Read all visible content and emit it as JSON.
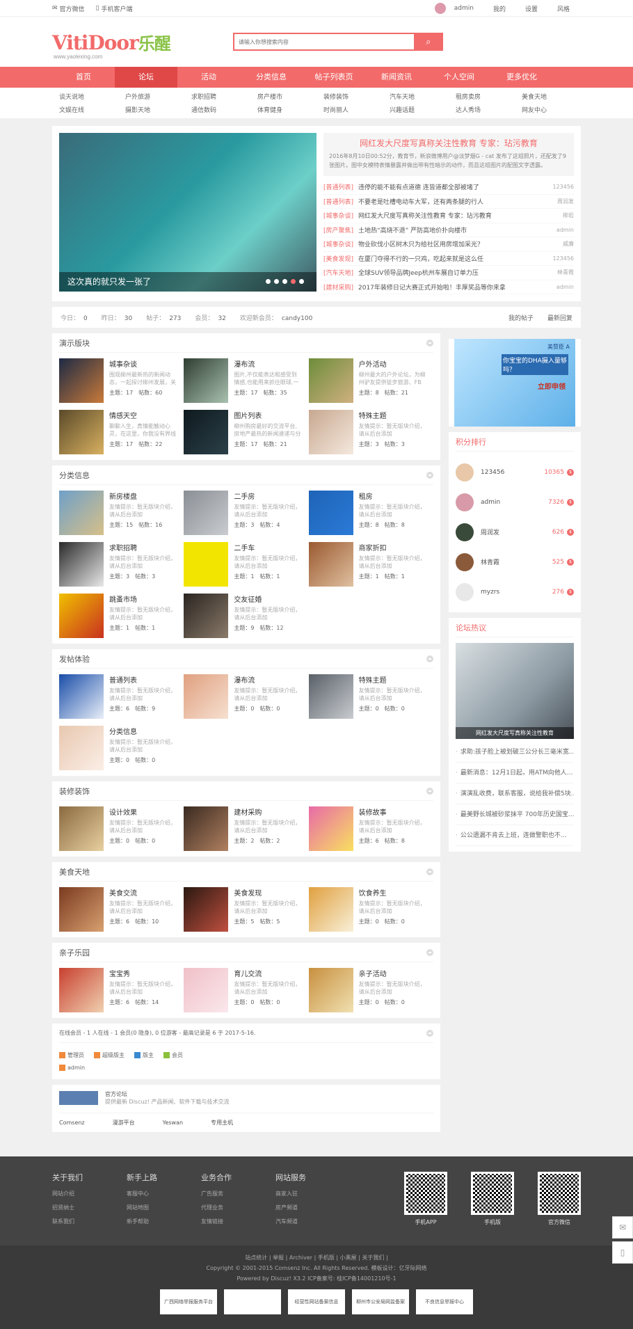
{
  "topbar": {
    "wechat": "官方微信",
    "mobile": "手机客户端",
    "user": "admin",
    "my": "我的",
    "settings": "设置",
    "style": "风格"
  },
  "header": {
    "logo_en": "VitiDoor",
    "logo_cn": "乐醒",
    "logo_url": "www.yaolexing.com",
    "search_placeholder": "请输入你想搜索内容"
  },
  "nav": [
    "首页",
    "论坛",
    "活动",
    "分类信息",
    "帖子列表页",
    "新闻资讯",
    "个人空间",
    "更多优化"
  ],
  "subnav": [
    "谈天说地",
    "户外旅游",
    "求职招聘",
    "房产楼市",
    "装修装饰",
    "汽车天地",
    "租房卖房",
    "美食天地",
    "文娱在线",
    "摄影天地",
    "通信数码",
    "体育健身",
    "时尚丽人",
    "兴趣话题",
    "达人秀场",
    "网友中心"
  ],
  "slider": {
    "caption": "这次真的就只发一张了"
  },
  "headline": {
    "title": "网红发大尺度写真称关注性教育 专家：玷污教育",
    "summary": "2016年8月10日00:52分，教育节，新浪微博用户@淡梦烟G - cat 发布了这组照片，还配发了9张图片。图中女模特表情暴露并做出带有性暗示的动作，而且这组图片的配图文字透露。"
  },
  "news": [
    {
      "cat": "[普通列表]",
      "title": "违停的能不能有点道德 连皆道都全部被堵了",
      "user": "123456"
    },
    {
      "cat": "[普通列表]",
      "title": "不要老是吐槽电动车大军，还有两条腿的行人",
      "user": "周润发"
    },
    {
      "cat": "[城事杂谈]",
      "title": "网红发大尺度写真称关注性教育 专家：玷污教育",
      "user": "柳岩"
    },
    {
      "cat": "[房产聚焦]",
      "title": "土地热“高烧不退” 严防高地价扑向楼市",
      "user": "admin"
    },
    {
      "cat": "[城事杂谈]",
      "title": "物业砍伐小区树木只为给社区用房增加采光？",
      "user": "威廉"
    },
    {
      "cat": "[美食发现]",
      "title": "在厦门夺得不行的一只鸡，吃起来就是这么任",
      "user": "123456"
    },
    {
      "cat": "[汽车天地]",
      "title": "全球SUV领导品牌Jeep杭州车展自订单力压",
      "user": "林青霞"
    },
    {
      "cat": "[建材采购]",
      "title": "2017年装修日记大赛正式开始啦！丰厚奖品等你来拿",
      "user": "admin"
    }
  ],
  "stats": {
    "today_l": "今日：",
    "today": "0",
    "yesterday_l": "昨日：",
    "yesterday": "30",
    "posts_l": "帖子：",
    "posts": "273",
    "members_l": "会员：",
    "members": "32",
    "welcome_l": "欢迎新会员：",
    "welcome": "candy100",
    "my_posts": "我的帖子",
    "latest": "最新回复"
  },
  "labels": {
    "topic": "主题：",
    "post": "帖数："
  },
  "blocks": [
    {
      "title": "演示版块",
      "forums": [
        {
          "name": "城事杂谈",
          "desc": "围观柳州最新热的新闻动态，一起探讨柳州发展，关注",
          "t": "17",
          "p": "60",
          "c1": "#1d2a44",
          "c2": "#c97a3a"
        },
        {
          "name": "瀑布流",
          "desc": "图片,不仅能表达和感受到情感,也能用来抓住眼球,一张美丽大",
          "t": "17",
          "p": "35",
          "c1": "#2f3e32",
          "c2": "#a9c1b0"
        },
        {
          "name": "户外活动",
          "desc": "柳州最大的户外论坛，为柳州驴友提供徒步旅游、FB露营。",
          "t": "8",
          "p": "21",
          "c1": "#6d8d3a",
          "c2": "#d0b080"
        },
        {
          "name": "情感天空",
          "desc": "聊聊人生，真情能触动心灵，在这里，你我没有界线的倾倒",
          "t": "17",
          "p": "22",
          "c1": "#5a4a2a",
          "c2": "#d8b060"
        },
        {
          "name": "图片列表",
          "desc": "柳州购房最好的交流平台,房地产最热的新闻速递与分享,共同",
          "t": "17",
          "p": "21",
          "c1": "#0e1a1f",
          "c2": "#2c4048"
        },
        {
          "name": "特殊主题",
          "desc": "友情提示：暂无版块介绍，请从后台添加",
          "t": "3",
          "p": "3",
          "c1": "#c8a890",
          "c2": "#f4e8de"
        }
      ]
    },
    {
      "title": "分类信息",
      "forums": [
        {
          "name": "新房楼盘",
          "desc": "友情提示：暂无版块介绍，请从后台添加",
          "t": "15",
          "p": "16",
          "c1": "#6fa0c8",
          "c2": "#d7c089"
        },
        {
          "name": "二手房",
          "desc": "友情提示：暂无版块介绍，请从后台添加",
          "t": "3",
          "p": "4",
          "c1": "#8a8f95",
          "c2": "#c9ccd0"
        },
        {
          "name": "租房",
          "desc": "友情提示：暂无版块介绍，请从后台添加",
          "t": "8",
          "p": "8",
          "c1": "#1e64b8",
          "c2": "#2a7ad6"
        },
        {
          "name": "求职招聘",
          "desc": "友情提示：暂无版块介绍，请从后台添加",
          "t": "3",
          "p": "3",
          "c1": "#2a2a2a",
          "c2": "#e8e8e8"
        },
        {
          "name": "二手车",
          "desc": "友情提示：暂无版块介绍，请从后台添加",
          "t": "1",
          "p": "1",
          "c1": "#f2e600",
          "c2": "#f2e600"
        },
        {
          "name": "商家折扣",
          "desc": "友情提示：暂无版块介绍，请从后台添加",
          "t": "1",
          "p": "1",
          "c1": "#9a5a30",
          "c2": "#e0c0a0"
        },
        {
          "name": "跳蚤市场",
          "desc": "友情提示：暂无版块介绍，请从后台添加",
          "t": "1",
          "p": "1",
          "c1": "#f0c000",
          "c2": "#c83020"
        },
        {
          "name": "交友征婚",
          "desc": "友情提示：暂无版块介绍，请从后台添加",
          "t": "9",
          "p": "12",
          "c1": "#2a2420",
          "c2": "#8a7a6a"
        }
      ]
    },
    {
      "title": "发帖体验",
      "forums": [
        {
          "name": "普通列表",
          "desc": "友情提示：暂无版块介绍，请从后台添加",
          "t": "6",
          "p": "9",
          "c1": "#1a4ea8",
          "c2": "#e8eef8"
        },
        {
          "name": "瀑布流",
          "desc": "友情提示：暂无版块介绍，请从后台添加",
          "t": "0",
          "p": "0",
          "c1": "#e0a080",
          "c2": "#f6e0d0"
        },
        {
          "name": "特殊主题",
          "desc": "友情提示：暂无版块介绍，请从后台添加",
          "t": "0",
          "p": "0",
          "c1": "#5a6068",
          "c2": "#c8ccd0"
        },
        {
          "name": "分类信息",
          "desc": "友情提示：暂无版块介绍，请从后台添加",
          "t": "0",
          "p": "0",
          "c1": "#e8c8b0",
          "c2": "#fbeee6"
        }
      ]
    },
    {
      "title": "装修装饰",
      "forums": [
        {
          "name": "设计效果",
          "desc": "友情提示：暂无版块介绍，请从后台添加",
          "t": "0",
          "p": "0",
          "c1": "#8a6a40",
          "c2": "#e8d0a0"
        },
        {
          "name": "建材采购",
          "desc": "友情提示：暂无版块介绍，请从后台添加",
          "t": "2",
          "p": "2",
          "c1": "#3a2a20",
          "c2": "#b08060"
        },
        {
          "name": "装修故事",
          "desc": "友情提示：暂无版块介绍，请从后台添加",
          "t": "6",
          "p": "8",
          "c1": "#e86aa8",
          "c2": "#f8e060"
        }
      ]
    },
    {
      "title": "美食天地",
      "forums": [
        {
          "name": "美食交流",
          "desc": "友情提示：暂无版块介绍，请从后台添加",
          "t": "6",
          "p": "10",
          "c1": "#7a3a20",
          "c2": "#d8a070"
        },
        {
          "name": "美食发现",
          "desc": "友情提示：暂无版块介绍，请从后台添加",
          "t": "5",
          "p": "5",
          "c1": "#2a1810",
          "c2": "#c05040"
        },
        {
          "name": "饮食养生",
          "desc": "友情提示：暂无版块介绍，请从后台添加",
          "t": "0",
          "p": "0",
          "c1": "#e0a040",
          "c2": "#f8f0d8"
        }
      ]
    },
    {
      "title": "亲子乐园",
      "forums": [
        {
          "name": "宝宝秀",
          "desc": "友情提示：暂无版块介绍，请从后台添加",
          "t": "6",
          "p": "14",
          "c1": "#c84030",
          "c2": "#f0d0b0"
        },
        {
          "name": "育儿交流",
          "desc": "友情提示：暂无版块介绍，请从后台添加",
          "t": "0",
          "p": "0",
          "c1": "#f0c0c8",
          "c2": "#fae8ec"
        },
        {
          "name": "亲子活动",
          "desc": "友情提示：暂无版块介绍，请从后台添加",
          "t": "0",
          "p": "0",
          "c1": "#c89040",
          "c2": "#f0e0b0"
        }
      ]
    }
  ],
  "online": {
    "summary": "在线会员 - 1 人在线 - 1 会员(0 隐身), 0 位游客 - 最高记录是 6 于 2017-5-16.",
    "legend": [
      "管理员",
      "超级版主",
      "版主",
      "会员"
    ],
    "user": "admin"
  },
  "friendlinks": {
    "name": "官方论坛",
    "desc": "提供最新 Discuz! 产品新闻、软件下载与技术交流",
    "items": [
      "Comsenz",
      "漫游平台",
      "Yeswan",
      "专用主机"
    ]
  },
  "ad": {
    "brand": "美赞臣 A",
    "headline": "你宝宝的DHA摄入量够吗？",
    "sub": "立即申领"
  },
  "ranking": {
    "title": "积分排行",
    "items": [
      {
        "name": "123456",
        "score": "10365",
        "c": "#e8c8a8"
      },
      {
        "name": "admin",
        "score": "7326",
        "c": "#d89aa8"
      },
      {
        "name": "周润发",
        "score": "626",
        "c": "#3a4a3a"
      },
      {
        "name": "林青霞",
        "score": "525",
        "c": "#8a5a3a"
      },
      {
        "name": "myzrs",
        "score": "276",
        "c": "#e8e8e8"
      }
    ]
  },
  "hot": {
    "title": "论坛热议",
    "caption": "网红发大尺度写真称关注性教育",
    "items": [
      "求助:孩子脸上被划破三公分长三毫米宽...",
      "最新消息：12月1日起，用ATM向他人...",
      "演演乱收费，联系客服，说给我补偿5块...",
      "最美野长城被砂浆抹平 700年历史国宝...",
      "公公遗漏不肯去上班，连做警职也不..."
    ]
  },
  "footer": {
    "cols": [
      {
        "title": "关于我们",
        "links": [
          "网站介绍",
          "招贤纳士",
          "联系我们"
        ]
      },
      {
        "title": "新手上路",
        "links": [
          "客服中心",
          "网站地图",
          "新手帮助"
        ]
      },
      {
        "title": "业务合作",
        "links": [
          "广告服务",
          "代理业务",
          "友情链接"
        ]
      },
      {
        "title": "网站服务",
        "links": [
          "商家入驻",
          "房产频道",
          "汽车频道"
        ]
      }
    ],
    "qrs": [
      "手机APP",
      "手机版",
      "官方微信"
    ],
    "line1": "站点统计 | 举报 | Archiver | 手机版 | 小黑屋 | 关于我们 |",
    "line2": "Copyright © 2001-2015 Comsenz Inc. All Rights Reserved.  模板设计：亿牙际网络",
    "line3": "Powered by Discuz! X3.2  ICP备案号: 桂ICP备14001210号-1",
    "badges": [
      "广西网络举报服务平台",
      "",
      "经营性网站备案信息",
      "柳州市公安局网监备案",
      "不良信息举报中心"
    ]
  }
}
